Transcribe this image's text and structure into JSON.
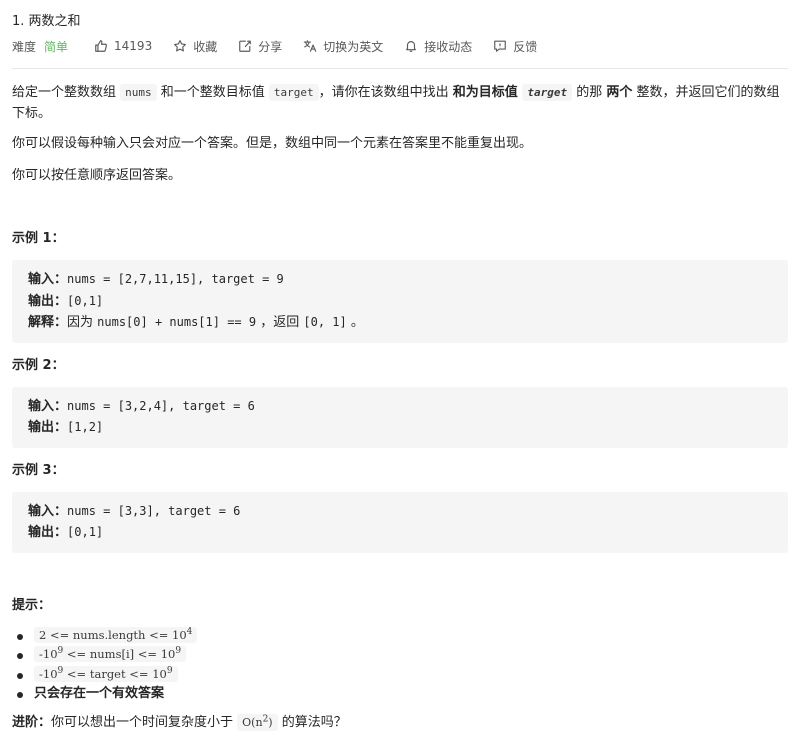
{
  "problem": {
    "title": "1. 两数之和"
  },
  "meta": {
    "difficulty_label": "难度",
    "difficulty_value": "简单",
    "likes": "14193",
    "favorite_label": "收藏",
    "share_label": "分享",
    "switch_lang_label": "切换为英文",
    "subscribe_label": "接收动态",
    "feedback_label": "反馈"
  },
  "colors": {
    "difficulty_easy": "#5cb85c",
    "text": "#262626",
    "muted": "#595959",
    "code_bg": "#f5f5f5"
  },
  "icons": {
    "likes": "thumbs-up-icon",
    "favorite": "star-icon",
    "share": "share-icon",
    "switch_lang": "translate-icon",
    "subscribe": "bell-icon",
    "feedback": "feedback-icon"
  },
  "description": {
    "p1_a": "给定一个整数数组 ",
    "p1_code1": "nums",
    "p1_b": " 和一个整数目标值 ",
    "p1_code2": "target",
    "p1_c": "，请你在该数组中找出 ",
    "p1_bold1": "和为目标值",
    "p1_code3": "target",
    "p1_d": "  的那 ",
    "p1_bold2": "两个",
    "p1_e": " 整数，并返回它们的数组下标。",
    "p2": "你可以假设每种输入只会对应一个答案。但是，数组中同一个元素在答案里不能重复出现。",
    "p3": "你可以按任意顺序返回答案。"
  },
  "examples": [
    {
      "title": "示例 1：",
      "input_label": "输入：",
      "input_value": "nums = [2,7,11,15], target = 9",
      "output_label": "输出：",
      "output_value": "[0,1]",
      "explain_label": "解释：",
      "explain_a": "因为 ",
      "explain_code": "nums[0] + nums[1] == 9",
      "explain_b": " ，返回 ",
      "explain_code2": "[0, 1]",
      "explain_c": " 。"
    },
    {
      "title": "示例 2：",
      "input_label": "输入：",
      "input_value": "nums = [3,2,4], target = 6",
      "output_label": "输出：",
      "output_value": "[1,2]"
    },
    {
      "title": "示例 3：",
      "input_label": "输入：",
      "input_value": "nums = [3,3], target = 6",
      "output_label": "输出：",
      "output_value": "[0,1]"
    }
  ],
  "hints": {
    "title": "提示：",
    "c1_a": "2 <= nums.length <= 10",
    "c1_sup": "4",
    "c2_a": "-10",
    "c2_sup1": "9",
    "c2_b": " <= nums[i] <= 10",
    "c2_sup2": "9",
    "c3_a": "-10",
    "c3_sup1": "9",
    "c3_b": " <= target <= 10",
    "c3_sup2": "9",
    "c4": "只会存在一个有效答案"
  },
  "advanced": {
    "label": "进阶：",
    "text_a": "你可以想出一个时间复杂度小于 ",
    "code_a": "O(n",
    "code_sup": "2",
    "code_b": ")",
    "text_b": " 的算法吗？"
  }
}
